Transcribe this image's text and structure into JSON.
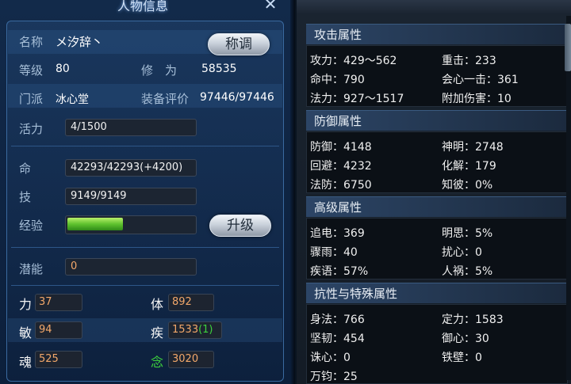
{
  "left": {
    "title": "人物信息",
    "close_icon": "close-icon",
    "name_label": "名称",
    "name_value": "メ汐辞丶",
    "title_button": "称调",
    "level_label": "等级",
    "level_value": "80",
    "cultivation_label": "修　为",
    "cultivation_value": "58535",
    "sect_label": "门派",
    "sect_value": "冰心堂",
    "gear_label": "装备评价",
    "gear_value": "97446/97446",
    "vitality_label": "活力",
    "vitality_value": "4/1500",
    "life_label": "命",
    "life_value": "42293/42293(+4200)",
    "skill_label": "技",
    "skill_value": "9149/9149",
    "exp_label": "经验",
    "exp_fraction": 0.44,
    "upgrade_button": "升级",
    "potential_label": "潜能",
    "potential_value": "0",
    "stats": {
      "str_label": "力",
      "str_value": "37",
      "con_label": "体",
      "con_value": "892",
      "agi_label": "敏",
      "agi_value": "94",
      "spd_label": "疾",
      "spd_value": "1533",
      "spd_bonus": "(1)",
      "soul_label": "魂",
      "soul_value": "525",
      "mind_label": "念",
      "mind_value": "3020"
    }
  },
  "right": {
    "attack": {
      "header": "攻击属性",
      "rows": [
        [
          "攻力：429～562",
          "重击：233"
        ],
        [
          "命中：790",
          "会心一击：361"
        ],
        [
          "法力：927～1517",
          "附加伤害：10"
        ]
      ]
    },
    "defense": {
      "header": "防御属性",
      "rows": [
        [
          "防御：4148",
          "神明：2748"
        ],
        [
          "回避：4232",
          "化解：179"
        ],
        [
          "法防：6750",
          "知彼：0%"
        ]
      ]
    },
    "advanced": {
      "header": "高级属性",
      "rows": [
        [
          "追电：369",
          "明思：5%"
        ],
        [
          "骤雨：40",
          "扰心：0"
        ],
        [
          "疾语：57%",
          "人祸：5%"
        ]
      ]
    },
    "resist": {
      "header": "抗性与特殊属性",
      "rows": [
        [
          "身法：766",
          "定力：1583"
        ],
        [
          "坚韧：454",
          "御心：30"
        ],
        [
          "诛心：0",
          "铁壁：0"
        ],
        [
          "万钧：25",
          ""
        ]
      ]
    }
  },
  "colors": {
    "stat_value": "#f3a86a",
    "mind_label": "#3dd13d",
    "spd_bonus": "#3dd13d",
    "exp_bar": "#5fc22e"
  }
}
